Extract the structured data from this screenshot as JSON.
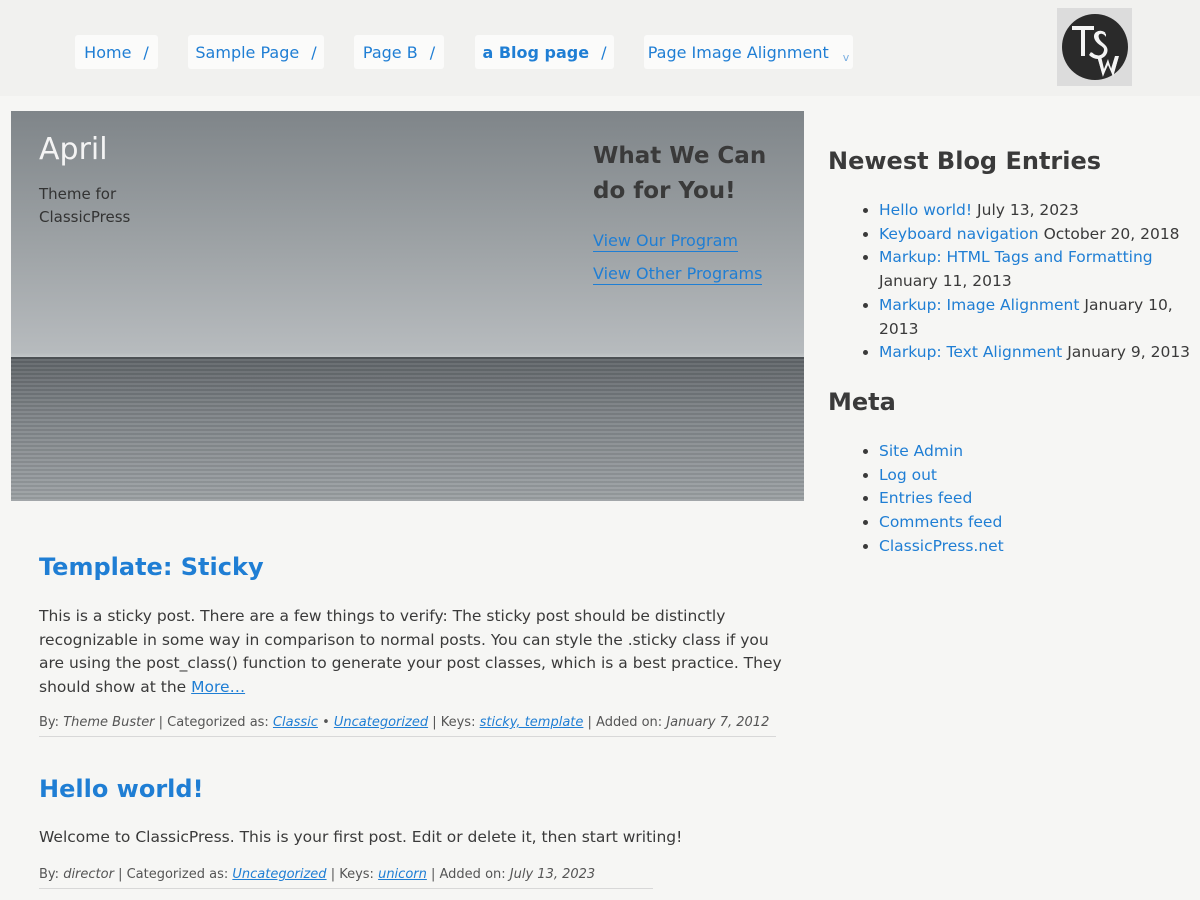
{
  "nav": {
    "items": [
      {
        "label": "Home",
        "sep": "/"
      },
      {
        "label": "Sample Page",
        "sep": "/"
      },
      {
        "label": "Page B",
        "sep": "/"
      },
      {
        "label": "a Blog page",
        "sep": "/"
      },
      {
        "label": "Page Image Alignment",
        "sep": "v"
      }
    ],
    "logo_text": "TSW"
  },
  "hero": {
    "site_title": "April",
    "tagline": "Theme for ClassicPress",
    "heading": "What We Can do for You!",
    "links": [
      "View Our Program",
      "View Other Programs"
    ]
  },
  "posts": [
    {
      "title": "Template: Sticky",
      "excerpt": "This is a sticky post. There are a few things to verify: The sticky post should be distinctly recognizable in some way in comparison to normal posts. You can style the .sticky class if you are using the post_class() function to generate your post classes, which is a best practice. They should show at the",
      "more": "More…",
      "by_label": "By:",
      "author": "Theme Buster",
      "cat_label": "| Categorized as:",
      "categories": [
        "Classic",
        "Uncategorized"
      ],
      "cat_sep": "•",
      "keys_label": "| Keys:",
      "keys": "sticky, template",
      "added_label": "| Added on:",
      "date": "January 7, 2012"
    },
    {
      "title": "Hello world!",
      "excerpt": "Welcome to ClassicPress. This is your first post. Edit or delete it, then start writing!",
      "by_label": "By:",
      "author": "director",
      "cat_label": "| Categorized as:",
      "categories": [
        "Uncategorized"
      ],
      "keys_label": "| Keys:",
      "keys": "unicorn",
      "added_label": "| Added on:",
      "date": "July 13, 2023"
    }
  ],
  "sidebar": {
    "newest_title": "Newest Blog Entries",
    "newest": [
      {
        "link": "Hello world!",
        "date": "July 13, 2023"
      },
      {
        "link": "Keyboard navigation",
        "date": "October 20, 2018"
      },
      {
        "link": "Markup: HTML Tags and Formatting",
        "date": "January 11, 2013"
      },
      {
        "link": "Markup: Image Alignment",
        "date": "January 10, 2013"
      },
      {
        "link": "Markup: Text Alignment",
        "date": "January 9, 2013"
      }
    ],
    "meta_title": "Meta",
    "meta": [
      "Site Admin",
      "Log out",
      "Entries feed",
      "Comments feed",
      "ClassicPress.net"
    ]
  },
  "colors": {
    "link": "#1f7ed4",
    "text": "#3a3a3a",
    "background": "#f6f6f4"
  }
}
